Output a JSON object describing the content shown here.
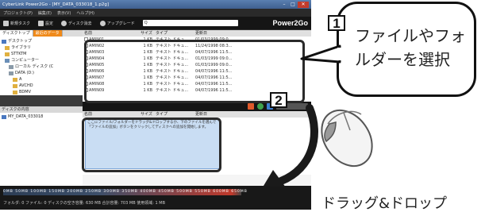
{
  "window": {
    "title": "CyberLink Power2Go - [MY_DATA_033018_1.p2g]"
  },
  "menu": [
    "プロジェクト(P)",
    "編集(E)",
    "表示(V)",
    "ヘルプ(H)"
  ],
  "toolbar": {
    "items": [
      "新規タスク",
      "設定",
      "ディスク消去",
      "アップグレード"
    ],
    "search_value": "Q",
    "brand": "Power2Go"
  },
  "left_panel": {
    "tabs": [
      "ディスクトップ",
      "最近のデータ"
    ],
    "tree": [
      "デスクトップ",
      "ライブラリ",
      "STTKTM",
      "コンピューター",
      "ローカル ディスク (C",
      "DATA (D:)",
      "A",
      "AVCHD",
      "BDMV"
    ],
    "disc_header": "ディスクの内容",
    "disc_item": "MY_DATA_033018"
  },
  "file_list": {
    "headers": [
      "名前",
      "サイズ",
      "タイプ",
      "更新日"
    ],
    "rows": [
      {
        "name": "AMIN01",
        "size": "1 KB",
        "type": "テキスト ドキュ...",
        "date": "01/03/1999 09:0..."
      },
      {
        "name": "AMIN02",
        "size": "1 KB",
        "type": "テキスト ドキュ...",
        "date": "11/24/1998 08:3..."
      },
      {
        "name": "AMIN03",
        "size": "1 KB",
        "type": "テキスト ドキュ...",
        "date": "04/07/1996 11:5..."
      },
      {
        "name": "AMIN04",
        "size": "1 KB",
        "type": "テキスト ドキュ...",
        "date": "01/03/1999 09:0..."
      },
      {
        "name": "AMIN05",
        "size": "1 KB",
        "type": "テキスト ドキュ...",
        "date": "01/03/1999 09:0..."
      },
      {
        "name": "AMIN06",
        "size": "1 KB",
        "type": "テキスト ドキュ...",
        "date": "04/07/1996 11:5..."
      },
      {
        "name": "AMIN07",
        "size": "1 KB",
        "type": "テキスト ドキュ...",
        "date": "04/07/1996 11:5..."
      },
      {
        "name": "AMIN08",
        "size": "1 KB",
        "type": "テキスト ドキュ...",
        "date": "04/07/1996 11:5..."
      },
      {
        "name": "AMIN09",
        "size": "1 KB",
        "type": "テキスト ドキュ...",
        "date": "04/07/1996 11:5..."
      }
    ]
  },
  "disc_list": {
    "headers": [
      "名前",
      "サイズ",
      "タイプ",
      "更新日"
    ],
    "drop_hint": "ここにファイル/フォルダーをドラッグ&ドロップするか、下のファイルを選んで「ファイルの追加」ボタンをクリックしてディスクへの追加を開始します。"
  },
  "status": {
    "capacity_ticks": "0MB 50MB 100MB 150MB 200MB 250MB 300MB 350MB 400MB 450MB 500MB 550MB 600MB 650MB",
    "info": "フォルダ: 0  ファイル: 0  ディスクの空き容量: 630 MB  合計容量: 703 MB  使用領域: 1 MB"
  },
  "annotations": {
    "step1": "1",
    "step2": "2",
    "bubble": "ファイルやフォルダーを選択",
    "drag_drop": "ドラッグ&ドロップ"
  }
}
